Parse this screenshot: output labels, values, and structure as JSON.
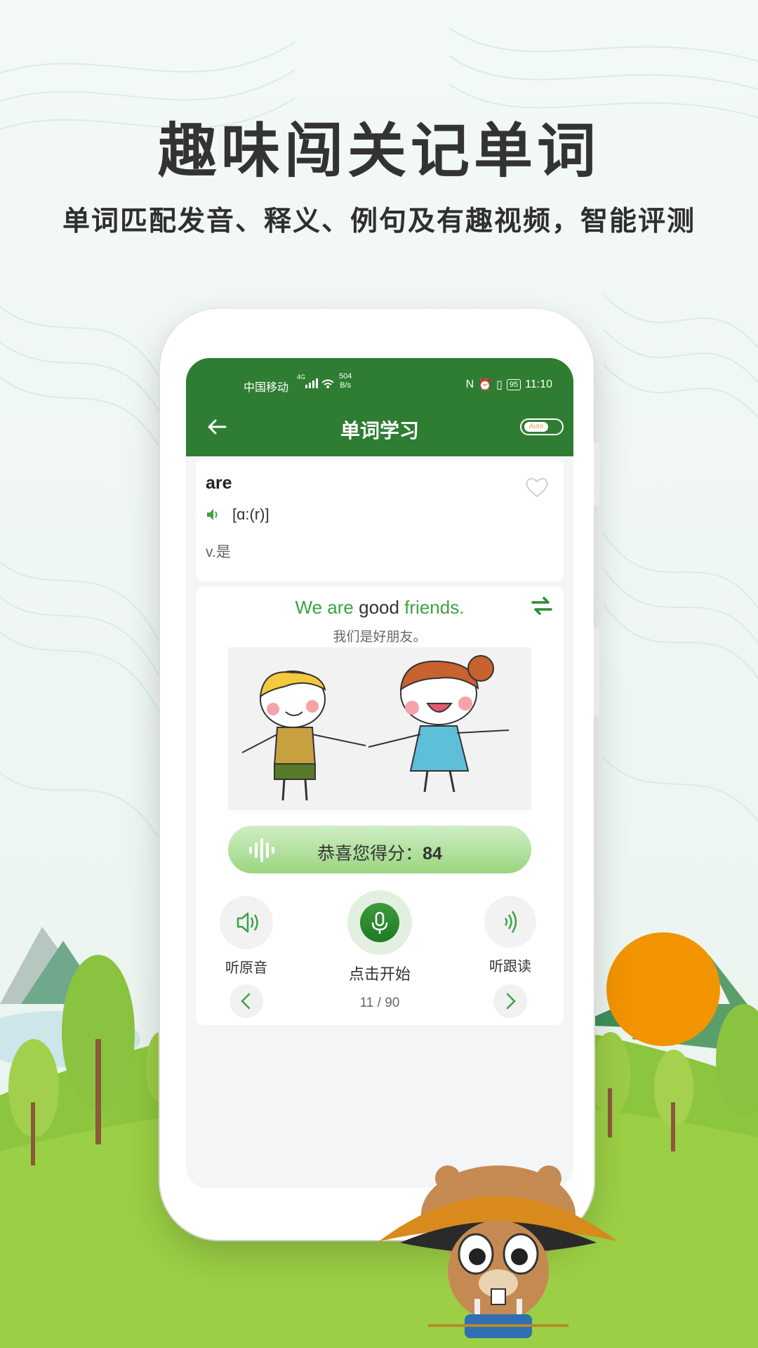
{
  "promo": {
    "headline": "趣味闯关记单词",
    "subline": "单词匹配发音、释义、例句及有趣视频，智能评测"
  },
  "status_bar": {
    "carrier": "中国移动",
    "network": "4G",
    "speed_value": "504",
    "speed_unit": "B/s",
    "battery": "95",
    "time": "11:10"
  },
  "app_bar": {
    "title": "单词学习",
    "auto_toggle_label": "Auto"
  },
  "word_card": {
    "word": "are",
    "phonetic": "[ɑ:(r)]",
    "meaning": "v.是"
  },
  "example_card": {
    "sentence_parts": [
      {
        "text": "We are ",
        "style": "green"
      },
      {
        "text": "good",
        "style": "dark"
      },
      {
        "text": " friends.",
        "style": "green"
      }
    ],
    "translation": "我们是好朋友。",
    "score_label": "恭喜您得分：",
    "score_value": "84",
    "listen_original_label": "听原音",
    "record_label": "点击开始",
    "listen_follow_label": "听跟读",
    "progress": "11 / 90"
  },
  "colors": {
    "primary_green": "#2e7d32",
    "accent_green": "#3aa344",
    "sun_orange": "#f29400"
  },
  "icons": [
    "back-arrow-icon",
    "heart-icon",
    "speaker-icon",
    "swap-icon",
    "voice-wave-icon",
    "speaker-outline-icon",
    "mic-icon",
    "follow-audio-icon",
    "chevron-left-icon",
    "chevron-right-icon"
  ]
}
